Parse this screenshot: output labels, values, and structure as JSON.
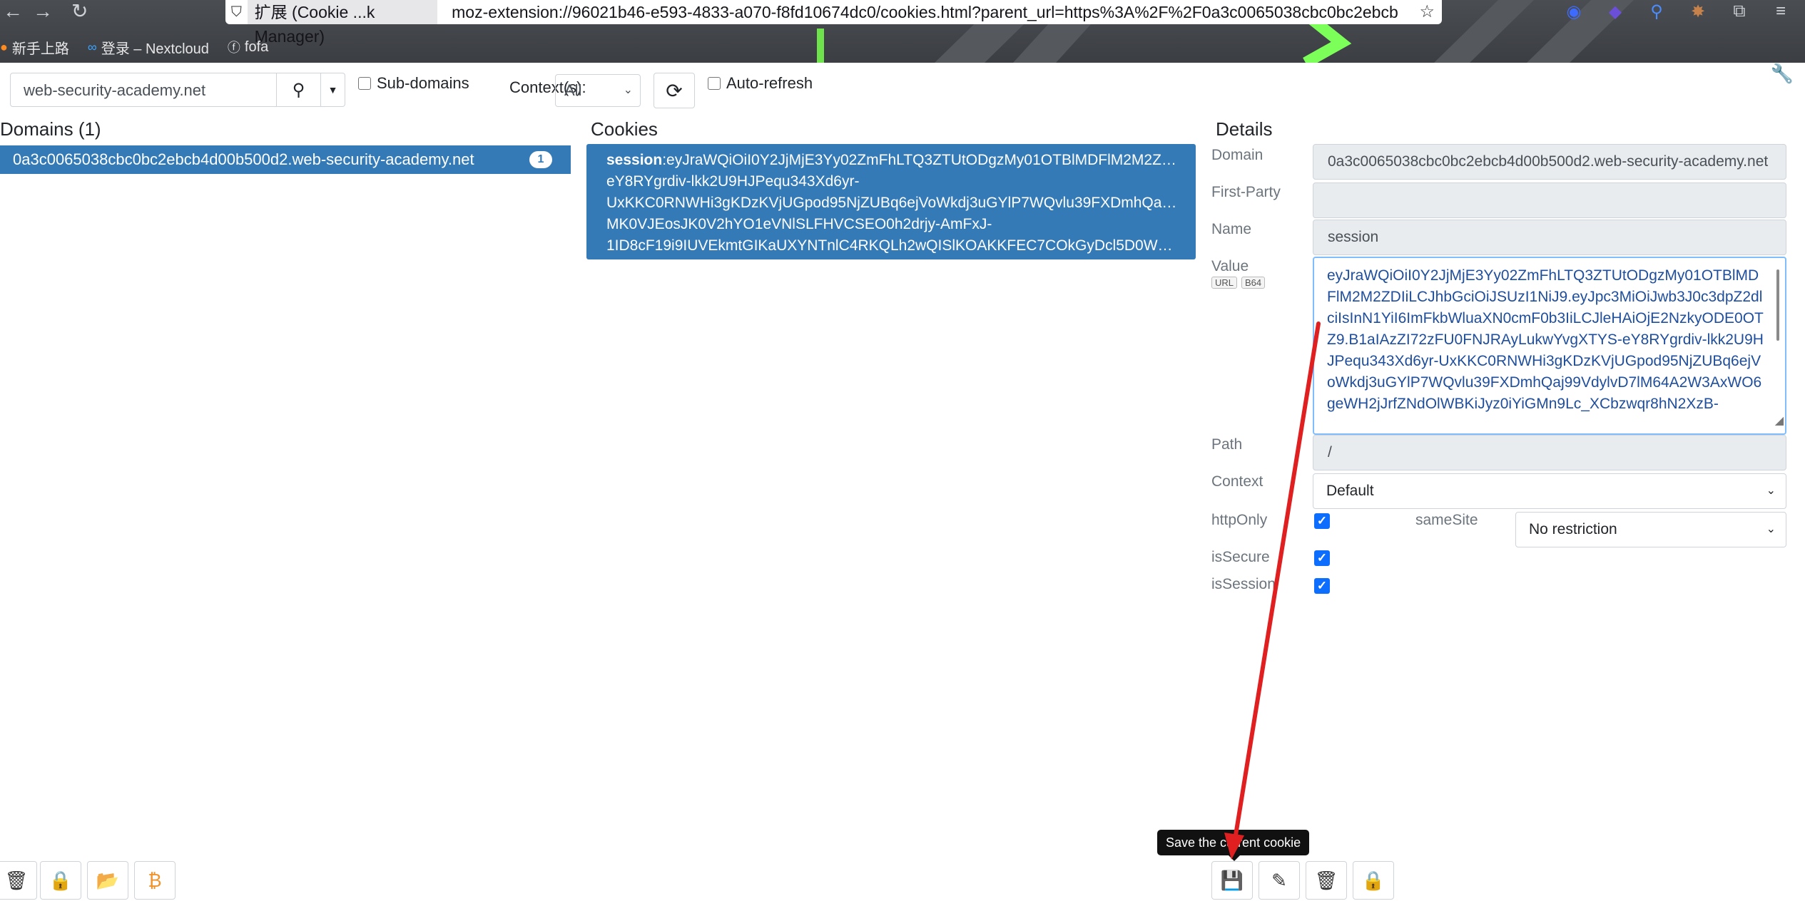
{
  "browser": {
    "tab_label": "扩展 (Cookie ...k Manager)",
    "url": "moz-extension://96021b46-e593-4833-a070-f8fd10674dc0/cookies.html?parent_url=https%3A%2F%2F0a3c0065038cbc0bc2ebcb",
    "bookmarks": [
      "新手上路",
      "登录 – Nextcloud",
      "fofa"
    ]
  },
  "toolbar": {
    "search_value": "web-security-academy.net",
    "subdomains_label": "Sub-domains",
    "context_label": "Context(s):",
    "context_value": "All",
    "autorefresh_label": "Auto-refresh"
  },
  "domains": {
    "title": "Domains (1)",
    "items": [
      {
        "name": "0a3c0065038cbc0bc2ebcb4d00b500d2.web-security-academy.net",
        "count": "1"
      }
    ]
  },
  "cookies": {
    "title": "Cookies",
    "items": [
      {
        "name": "session",
        "lines": [
          ":eyJraWQiOiI0Y2JjMjE3Yy02ZmFhLTQ3ZTUtODgzMy01OTBlMDFlM2M2Z…",
          "eY8RYgrdiv-lkk2U9HJPequ343Xd6yr-",
          "UxKKC0RNWHi3gKDzKVjUGpod95NjZUBq6ejVoWkdj3uGYlP7WQvlu39FXDmhQa…",
          "MK0VJEosJK0V2hYO1eVNlSLFHVCSEO0h2drjy-AmFxJ-",
          "1ID8cF19i9IUVEkmtGIKaUXYNTnlC4RKQLh2wQISlKOAKKFEC7COkGyDcl5D0W…"
        ]
      }
    ]
  },
  "details": {
    "title": "Details",
    "domain_label": "Domain",
    "domain_value": "0a3c0065038cbc0bc2ebcb4d00b500d2.web-security-academy.net",
    "firstparty_label": "First-Party",
    "firstparty_value": "",
    "name_label": "Name",
    "name_value": "session",
    "value_label": "Value",
    "value_badges": [
      "URL",
      "B64"
    ],
    "value_text": "eyJraWQiOiI0Y2JjMjE3Yy02ZmFhLTQ3ZTUtODgzMy01OTBlMDFlM2M2ZDIiLCJhbGciOiJSUzI1NiJ9.eyJpc3MiOiJwb3J0c3dpZ2dlciIsInN1YiI6ImFkbWluaXN0cmF0b3IiLCJleHAiOjE2NzkyODE0OTZ9.B1aIAzZI72zFU0FNJRAyLukwYvgXTYS-eY8RYgrdiv-lkk2U9HJPequ343Xd6yr-UxKKC0RNWHi3gKDzKVjUGpod95NjZUBq6ejVoWkdj3uGYlP7WQvlu39FXDmhQaj99VdylvD7lM64A2W3AxWO6geWH2jJrfZNdOlWBKiJyz0iYiGMn9Lc_XCbzwqr8hN2XzB-",
    "path_label": "Path",
    "path_value": "/",
    "context_label": "Context",
    "context_value": "Default",
    "httponly_label": "httpOnly",
    "samesite_label": "sameSite",
    "samesite_value": "No restriction",
    "issecure_label": "isSecure",
    "issession_label": "isSession"
  },
  "footer": {
    "tooltip": "Save the current cookie"
  },
  "colors": {
    "selection": "#337ab7",
    "checkbox": "#0d6efd",
    "annotation_arrow": "#e02020",
    "save_icon": "#f0932b"
  }
}
